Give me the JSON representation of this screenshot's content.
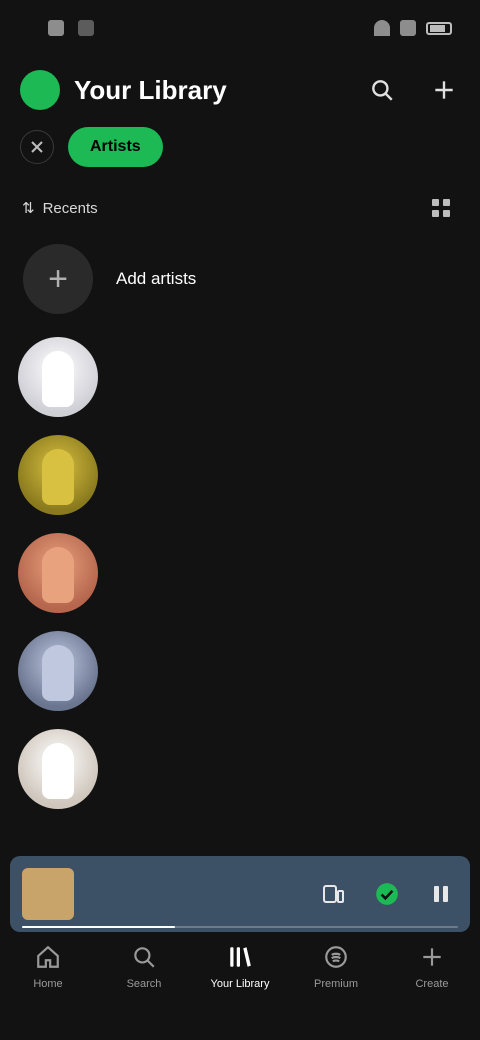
{
  "status_bar": {
    "time": "",
    "battery_level": 0.7
  },
  "header": {
    "avatar_letter": "",
    "title": "Your Library",
    "search_icon": "search-icon",
    "add_icon": "plus-icon"
  },
  "filters": {
    "close_icon": "close-icon",
    "active_chip": "Artists"
  },
  "sort": {
    "label": "Recents",
    "arrows_icon": "sort-arrows-icon",
    "grid_icon": "grid-icon"
  },
  "list": {
    "add_item": {
      "label": "Add artists",
      "icon": "plus-icon"
    },
    "artists": [
      {
        "name": "",
        "color": "#cfcfd6",
        "figure": "#ffffff"
      },
      {
        "name": "",
        "color": "#8a7a1e",
        "figure": "#d8c040"
      },
      {
        "name": "",
        "color": "#b5664d",
        "figure": "#e9a27e"
      },
      {
        "name": "",
        "color": "#6a7590",
        "figure": "#c0c8e0"
      },
      {
        "name": "",
        "color": "#cfc6bc",
        "figure": "#ffffff"
      }
    ]
  },
  "mini_player": {
    "title": "",
    "subtitle": "",
    "art_color": "#c9a46a",
    "bg_color": "#3d5166",
    "progress": 0.35,
    "devices_icon": "devices-icon",
    "added_icon": "check-circle-icon",
    "pause_icon": "pause-icon"
  },
  "bottom_nav": {
    "items": [
      {
        "label": "Home",
        "icon": "home-icon",
        "active": false
      },
      {
        "label": "Search",
        "icon": "search-icon",
        "active": false
      },
      {
        "label": "Your Library",
        "icon": "library-icon",
        "active": true
      },
      {
        "label": "Premium",
        "icon": "premium-icon",
        "active": false
      },
      {
        "label": "Create",
        "icon": "plus-icon",
        "active": false
      }
    ]
  },
  "colors": {
    "background": "#121212",
    "accent": "#1db954"
  }
}
